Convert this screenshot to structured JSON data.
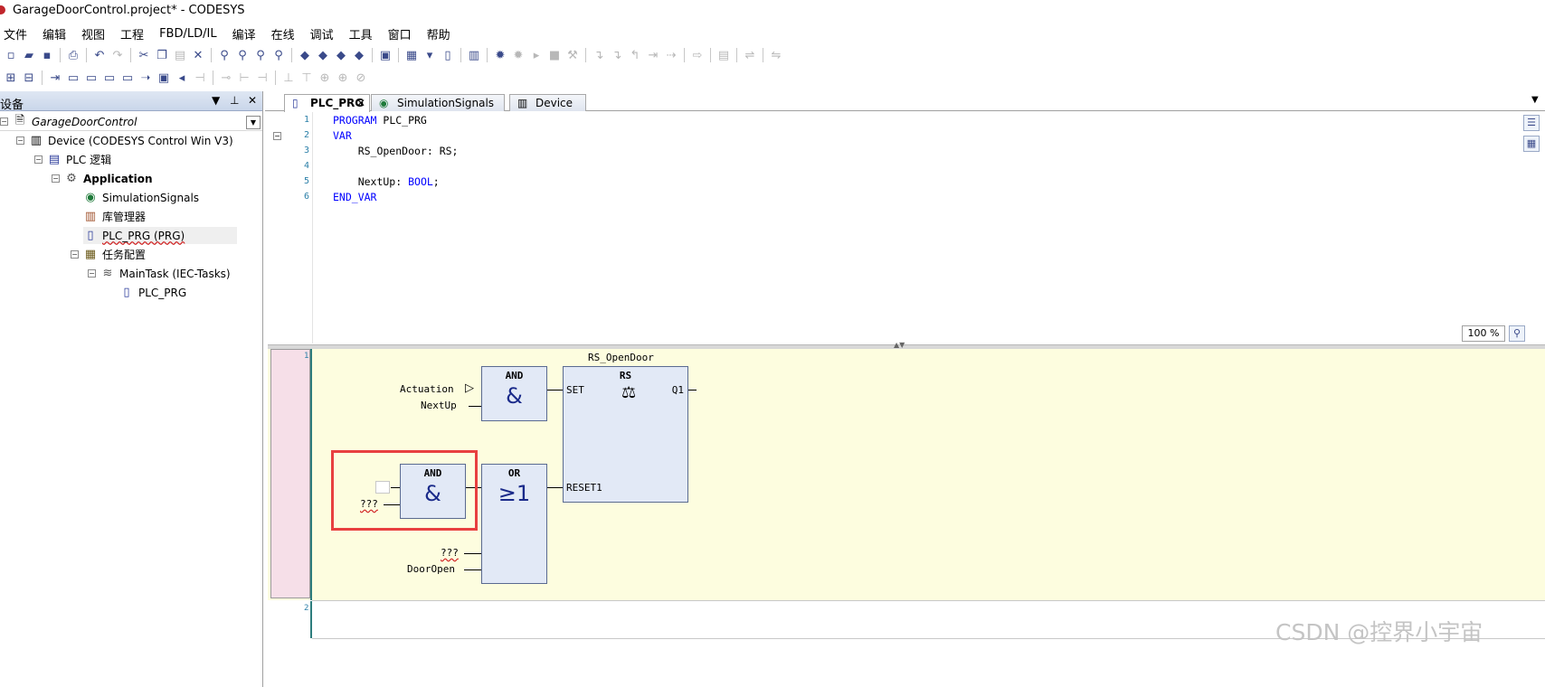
{
  "window": {
    "title": "GarageDoorControl.project* - CODESYS"
  },
  "menu": [
    "文件",
    "编辑",
    "视图",
    "工程",
    "FBD/LD/IL",
    "编译",
    "在线",
    "调试",
    "工具",
    "窗口",
    "帮助"
  ],
  "device_panel": {
    "title": "设备",
    "pin_icon": "pin-icon",
    "close_label": "✕",
    "tree": [
      {
        "label": "GarageDoorControl",
        "icon": "project-icon"
      },
      {
        "label": "Device (CODESYS Control Win V3)",
        "icon": "device-icon"
      },
      {
        "label": "PLC 逻辑",
        "icon": "plc-logic-icon"
      },
      {
        "label": "Application",
        "icon": "application-gear-icon"
      },
      {
        "label": "SimulationSignals",
        "icon": "globe-icon"
      },
      {
        "label": "库管理器",
        "icon": "library-icon"
      },
      {
        "label": "PLC_PRG (PRG)",
        "icon": "pou-icon"
      },
      {
        "label": "任务配置",
        "icon": "task-config-icon"
      },
      {
        "label": "MainTask (IEC-Tasks)",
        "icon": "task-icon"
      },
      {
        "label": "PLC_PRG",
        "icon": "program-call-icon"
      }
    ]
  },
  "tabs": [
    {
      "label": "PLC_PRG",
      "active": true,
      "icon": "pou-icon"
    },
    {
      "label": "SimulationSignals",
      "active": false,
      "icon": "globe-icon"
    },
    {
      "label": "Device",
      "active": false,
      "icon": "device-icon"
    }
  ],
  "declaration": {
    "line_numbers": [
      "1",
      "2",
      "3",
      "4",
      "5",
      "6"
    ],
    "lines": {
      "l1_kw": "PROGRAM",
      "l1_name": " PLC_PRG",
      "l2_kw": "VAR",
      "l3_text": "    RS_OpenDoor: RS;",
      "l5_text": "    NextUp: ",
      "l5_type": "BOOL",
      "l5_end": ";",
      "l6_kw": "END_VAR"
    },
    "zoom": "100 %"
  },
  "fbd": {
    "network_numbers": [
      "1",
      "2"
    ],
    "rs_instance": "RS_OpenDoor",
    "and1": {
      "name": "AND",
      "symbol": "&",
      "inputs": [
        "Actuation",
        "NextUp"
      ]
    },
    "rs": {
      "name": "RS",
      "pins": {
        "set": "SET",
        "reset": "RESET1",
        "q": "Q1"
      }
    },
    "and2": {
      "name": "AND",
      "symbol": "&",
      "input_placeholder": "???"
    },
    "or": {
      "name": "OR",
      "symbol": "≥1",
      "inputs": [
        "???",
        "DoorOpen"
      ]
    }
  },
  "watermark": "CSDN @控界小宇宙",
  "colors": {
    "network_bg": "#fdfddf",
    "fb_fill": "#e2e9f6",
    "highlight": "#e84040",
    "keyword": "#0000ff"
  }
}
